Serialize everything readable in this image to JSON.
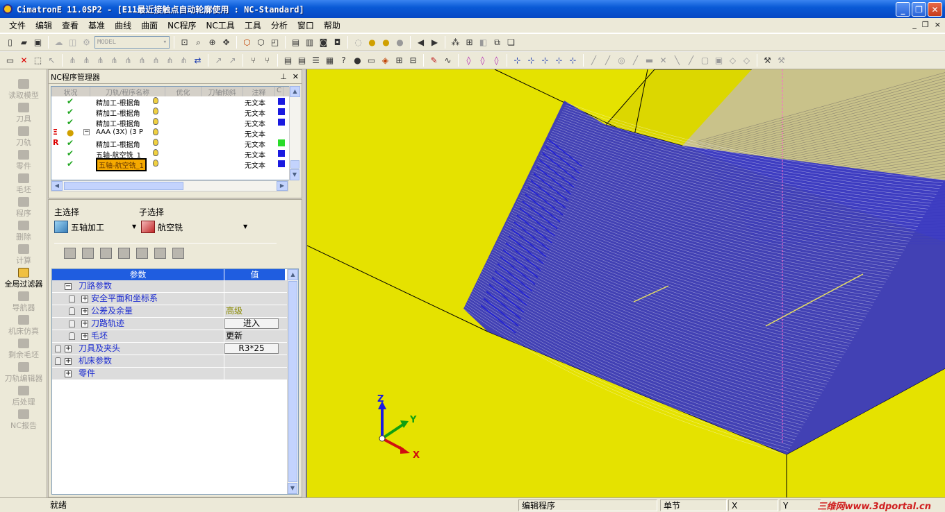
{
  "window": {
    "title": "CimatronE 11.0SP2 - [E11最近接触点自动轮廓使用 : NC-Standard]",
    "min_label": "_",
    "max_label": "❐",
    "close_label": "✕"
  },
  "menu": {
    "items": [
      "文件",
      "编辑",
      "查看",
      "基准",
      "曲线",
      "曲面",
      "NC程序",
      "NC工具",
      "工具",
      "分析",
      "窗口",
      "帮助"
    ],
    "mdi_min": "_",
    "mdi_restore": "❐",
    "mdi_close": "×"
  },
  "toolbar": {
    "model_combo": "MODEL"
  },
  "leftbar": {
    "items": [
      "读取模型",
      "刀具",
      "刀轨",
      "零件",
      "毛坯",
      "程序",
      "删除",
      "计算",
      "全局过滤器",
      "导航器",
      "机床仿真",
      "剩余毛坯",
      "刀轨编辑器",
      "后处理",
      "NC报告"
    ],
    "active_index": 8
  },
  "nc_manager": {
    "title": "NC程序管理器",
    "pin_label": "⊥",
    "close_label": "✕",
    "headers": [
      "状况",
      "刀轨/程序名称",
      "优化",
      "刀轴倾斜",
      "注释",
      "C"
    ],
    "rows": [
      {
        "name": "精加工-根据角",
        "comment": "无文本",
        "box": "blue"
      },
      {
        "name": "精加工-根据角",
        "comment": "无文本",
        "box": "blue"
      },
      {
        "name": "精加工-根据角",
        "comment": "无文本",
        "box": "blue"
      },
      {
        "name": "AAA (3X) (3 P",
        "comment": "无文本",
        "box": "none",
        "flag": "Ξ",
        "expand": "−"
      },
      {
        "name": "精加工-根据角",
        "comment": "无文本",
        "box": "green",
        "flag": "R"
      },
      {
        "name": "五轴-航空铣_1",
        "comment": "无文本",
        "box": "blue"
      },
      {
        "name": "五轴-航空铣_1",
        "comment": "无文本",
        "box": "blue",
        "selected": true
      }
    ]
  },
  "selection": {
    "main_label": "主选择",
    "sub_label": "子选择",
    "main_value": "五轴加工",
    "sub_value": "航空铣"
  },
  "params": {
    "col_param": "参数",
    "col_value": "值",
    "rows": [
      {
        "name": "刀路参数",
        "value": "",
        "indent": 0,
        "lock": false,
        "expand": "−"
      },
      {
        "name": "安全平面和坐标系",
        "value": "",
        "indent": 1,
        "lock": true,
        "expand": "+"
      },
      {
        "name": "公差及余量",
        "value": "高级",
        "indent": 1,
        "lock": true,
        "expand": "+",
        "value_color": "#8a8a00"
      },
      {
        "name": "刀路轨迹",
        "value": "进入",
        "indent": 1,
        "lock": true,
        "expand": "+",
        "button": true
      },
      {
        "name": "毛坯",
        "value": "更新",
        "indent": 1,
        "lock": true,
        "expand": "+"
      },
      {
        "name": "刀具及夹头",
        "value": "R3*25",
        "indent": 0,
        "lock": true,
        "expand": "+",
        "button": true
      },
      {
        "name": "机床参数",
        "value": "",
        "indent": 0,
        "lock": true,
        "expand": "+"
      },
      {
        "name": "零件",
        "value": "",
        "indent": 0,
        "lock": false,
        "expand": "+"
      }
    ]
  },
  "viewport": {
    "axis_x": "X",
    "axis_y": "Y",
    "axis_z": "Z",
    "colors": {
      "background": "#e5e200",
      "toolpath": "#1a1ae0",
      "edge": "#000000"
    }
  },
  "status": {
    "ready": "就绪",
    "mode": "编辑程序",
    "step": "单节",
    "x_label": "X",
    "y_label": "Y",
    "watermark": "三维网www.3dportal.cn"
  }
}
